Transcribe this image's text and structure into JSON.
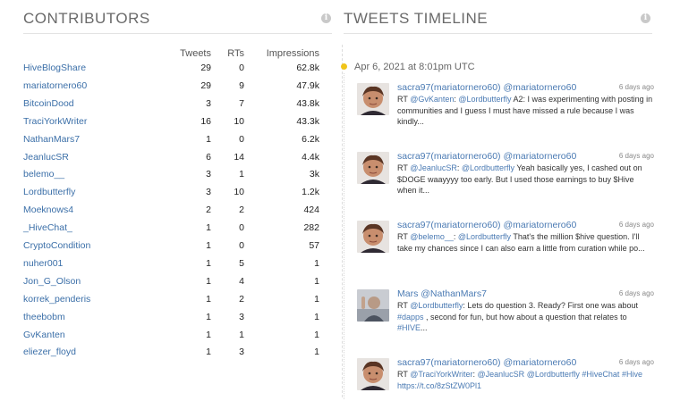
{
  "contributors": {
    "title": "CONTRIBUTORS",
    "columns": {
      "tweets": "Tweets",
      "rts": "RTs",
      "impressions": "Impressions"
    },
    "rows": [
      {
        "name": "HiveBlogShare",
        "tweets": "29",
        "rts": "0",
        "impressions": "62.8k"
      },
      {
        "name": "mariatornero60",
        "tweets": "29",
        "rts": "9",
        "impressions": "47.9k"
      },
      {
        "name": "BitcoinDood",
        "tweets": "3",
        "rts": "7",
        "impressions": "43.8k"
      },
      {
        "name": "TraciYorkWriter",
        "tweets": "16",
        "rts": "10",
        "impressions": "43.3k"
      },
      {
        "name": "NathanMars7",
        "tweets": "1",
        "rts": "0",
        "impressions": "6.2k"
      },
      {
        "name": "JeanlucSR",
        "tweets": "6",
        "rts": "14",
        "impressions": "4.4k"
      },
      {
        "name": "belemo__",
        "tweets": "3",
        "rts": "1",
        "impressions": "3k"
      },
      {
        "name": "Lordbutterfly",
        "tweets": "3",
        "rts": "10",
        "impressions": "1.2k"
      },
      {
        "name": "Moeknows4",
        "tweets": "2",
        "rts": "2",
        "impressions": "424"
      },
      {
        "name": "_HiveChat_",
        "tweets": "1",
        "rts": "0",
        "impressions": "282"
      },
      {
        "name": "CryptoCondition",
        "tweets": "1",
        "rts": "0",
        "impressions": "57"
      },
      {
        "name": "nuher001",
        "tweets": "1",
        "rts": "5",
        "impressions": "1"
      },
      {
        "name": "Jon_G_Olson",
        "tweets": "1",
        "rts": "4",
        "impressions": "1"
      },
      {
        "name": "korrek_penderis",
        "tweets": "1",
        "rts": "2",
        "impressions": "1"
      },
      {
        "name": "theebobm",
        "tweets": "1",
        "rts": "3",
        "impressions": "1"
      },
      {
        "name": "GvKanten",
        "tweets": "1",
        "rts": "1",
        "impressions": "1"
      },
      {
        "name": "eliezer_floyd",
        "tweets": "1",
        "rts": "3",
        "impressions": "1"
      }
    ]
  },
  "timeline": {
    "title": "TWEETS TIMELINE",
    "date": "Apr 6, 2021 at 8:01pm UTC",
    "tweets": [
      {
        "author": "sacra97(mariatornero60) @mariatornero60",
        "time": "6 days ago",
        "body": [
          {
            "t": "RT "
          },
          {
            "t": "@GvKanten",
            "link": true
          },
          {
            "t": ": "
          },
          {
            "t": "@Lordbutterfly",
            "link": true
          },
          {
            "t": " A2: I was experimenting with posting in communities and I guess I must have missed a rule because I was kindly..."
          }
        ]
      },
      {
        "author": "sacra97(mariatornero60) @mariatornero60",
        "time": "6 days ago",
        "body": [
          {
            "t": "RT "
          },
          {
            "t": "@JeanlucSR",
            "link": true
          },
          {
            "t": ": "
          },
          {
            "t": "@Lordbutterfly",
            "link": true
          },
          {
            "t": " Yeah basically yes, I cashed out on $DOGE waayyyy too early. But I used those earnings to buy $Hive when it..."
          }
        ]
      },
      {
        "author": "sacra97(mariatornero60) @mariatornero60",
        "time": "6 days ago",
        "body": [
          {
            "t": "RT "
          },
          {
            "t": "@belemo__",
            "link": true
          },
          {
            "t": ": "
          },
          {
            "t": "@Lordbutterfly",
            "link": true
          },
          {
            "t": " That's the million $hive question. I'll take my chances since I can also earn a little from curation while po..."
          }
        ]
      },
      {
        "author": "Mars @NathanMars7",
        "time": "6 days ago",
        "body": [
          {
            "t": "RT "
          },
          {
            "t": "@Lordbutterfly",
            "link": true
          },
          {
            "t": ": Lets do question 3. Ready? First one was about "
          },
          {
            "t": "#dapps",
            "link": true
          },
          {
            "t": " , second for fun, but how about a question that relates to "
          },
          {
            "t": "#HIVE",
            "link": true
          },
          {
            "t": "..."
          }
        ]
      },
      {
        "author": "sacra97(mariatornero60) @mariatornero60",
        "time": "6 days ago",
        "body": [
          {
            "t": "RT "
          },
          {
            "t": "@TraciYorkWriter",
            "link": true
          },
          {
            "t": ": "
          },
          {
            "t": "@JeanlucSR",
            "link": true
          },
          {
            "t": " "
          },
          {
            "t": "@Lordbutterfly",
            "link": true
          },
          {
            "t": " "
          },
          {
            "t": "#HiveChat",
            "link": true
          },
          {
            "t": " "
          },
          {
            "t": "#Hive",
            "link": true
          },
          {
            "t": " "
          },
          {
            "t": "https://t.co/8zStZW0Pl1",
            "link": true
          }
        ]
      }
    ]
  }
}
